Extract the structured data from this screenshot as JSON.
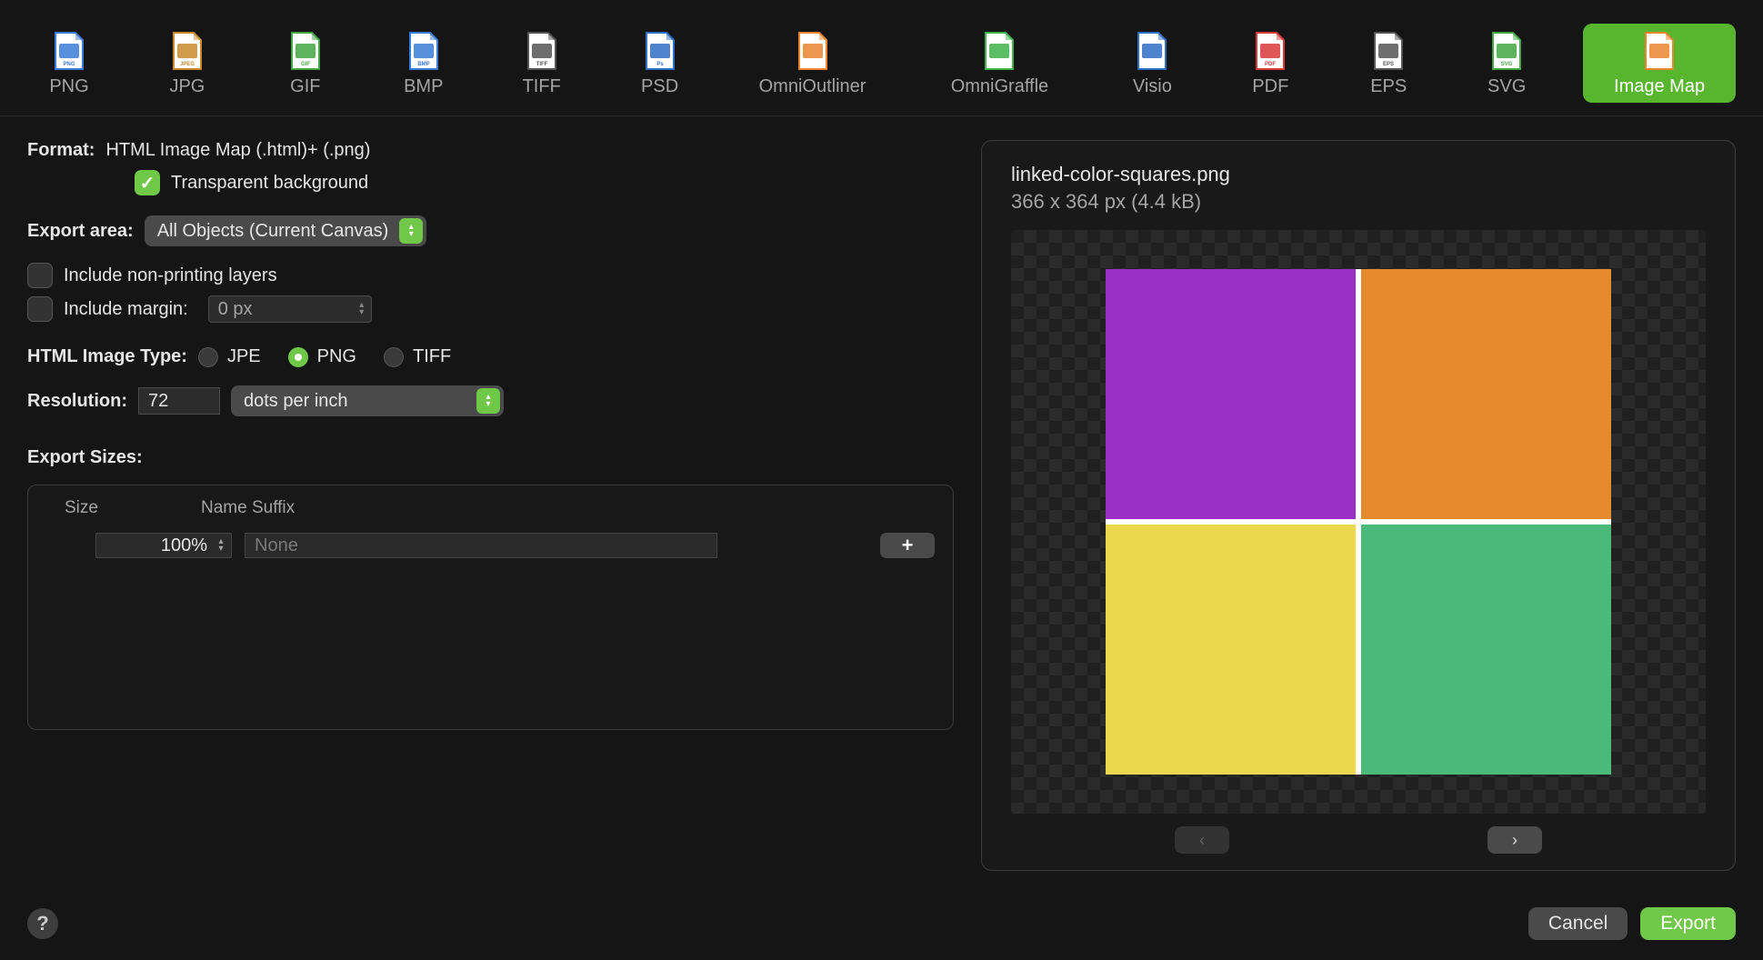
{
  "tabs": [
    {
      "id": "png",
      "label": "PNG",
      "icon": "png-file-icon",
      "accent": "#3a7bd5",
      "tag": "PNG"
    },
    {
      "id": "jpg",
      "label": "JPG",
      "icon": "jpeg-file-icon",
      "accent": "#c8892e",
      "tag": "JPEG"
    },
    {
      "id": "gif",
      "label": "GIF",
      "icon": "gif-file-icon",
      "accent": "#42a742",
      "tag": "GIF"
    },
    {
      "id": "bmp",
      "label": "BMP",
      "icon": "bmp-file-icon",
      "accent": "#3a7bd5",
      "tag": "BMP"
    },
    {
      "id": "tiff",
      "label": "TIFF",
      "icon": "tiff-file-icon",
      "accent": "#555555",
      "tag": "TIFF"
    },
    {
      "id": "psd",
      "label": "PSD",
      "icon": "psd-file-icon",
      "accent": "#2e6fc4",
      "tag": "Ps"
    },
    {
      "id": "oo",
      "label": "OmniOutliner",
      "icon": "omnioutliner-file-icon",
      "accent": "#e9852e",
      "tag": "",
      "wide": true
    },
    {
      "id": "og",
      "label": "OmniGraffle",
      "icon": "omnigraffle-file-icon",
      "accent": "#3fb24a",
      "tag": "",
      "wide": true
    },
    {
      "id": "visio",
      "label": "Visio",
      "icon": "visio-file-icon",
      "accent": "#2e6fc4",
      "tag": ""
    },
    {
      "id": "pdf",
      "label": "PDF",
      "icon": "pdf-file-icon",
      "accent": "#d83a3a",
      "tag": "PDF"
    },
    {
      "id": "eps",
      "label": "EPS",
      "icon": "eps-file-icon",
      "accent": "#555555",
      "tag": "EPS"
    },
    {
      "id": "svg",
      "label": "SVG",
      "icon": "svg-file-icon",
      "accent": "#42a742",
      "tag": "SVG"
    },
    {
      "id": "imagemap",
      "label": "Image Map",
      "icon": "html-file-icon",
      "accent": "#e9852e",
      "tag": "",
      "selected": true,
      "wide": true
    }
  ],
  "format": {
    "label": "Format:",
    "value": "HTML Image Map (.html)+ (.png)",
    "transparent_label": "Transparent background",
    "transparent_checked": true
  },
  "export_area": {
    "label": "Export area:",
    "value": "All Objects (Current Canvas)",
    "include_nonprinting_label": "Include non-printing layers",
    "include_nonprinting_checked": false,
    "include_margin_label": "Include margin:",
    "include_margin_checked": false,
    "margin_value": "0 px"
  },
  "html_image_type": {
    "label": "HTML Image Type:",
    "options": [
      "JPE",
      "PNG",
      "TIFF"
    ],
    "selected": "PNG"
  },
  "resolution": {
    "label": "Resolution:",
    "value": "72",
    "unit": "dots per inch"
  },
  "export_sizes": {
    "label": "Export Sizes:",
    "columns": {
      "size": "Size",
      "suffix": "Name Suffix"
    },
    "rows": [
      {
        "size": "100%",
        "suffix_placeholder": "None"
      }
    ],
    "add_label": "+"
  },
  "preview": {
    "filename": "linked-color-squares.png",
    "meta": "366 x 364 px (4.4 kB)",
    "colors": {
      "tl": "#9b30c6",
      "tr": "#e68a2e",
      "bl": "#ebd84c",
      "br": "#4bb97a"
    }
  },
  "buttons": {
    "help": "?",
    "cancel": "Cancel",
    "export": "Export",
    "prev": "‹",
    "next": "›"
  }
}
